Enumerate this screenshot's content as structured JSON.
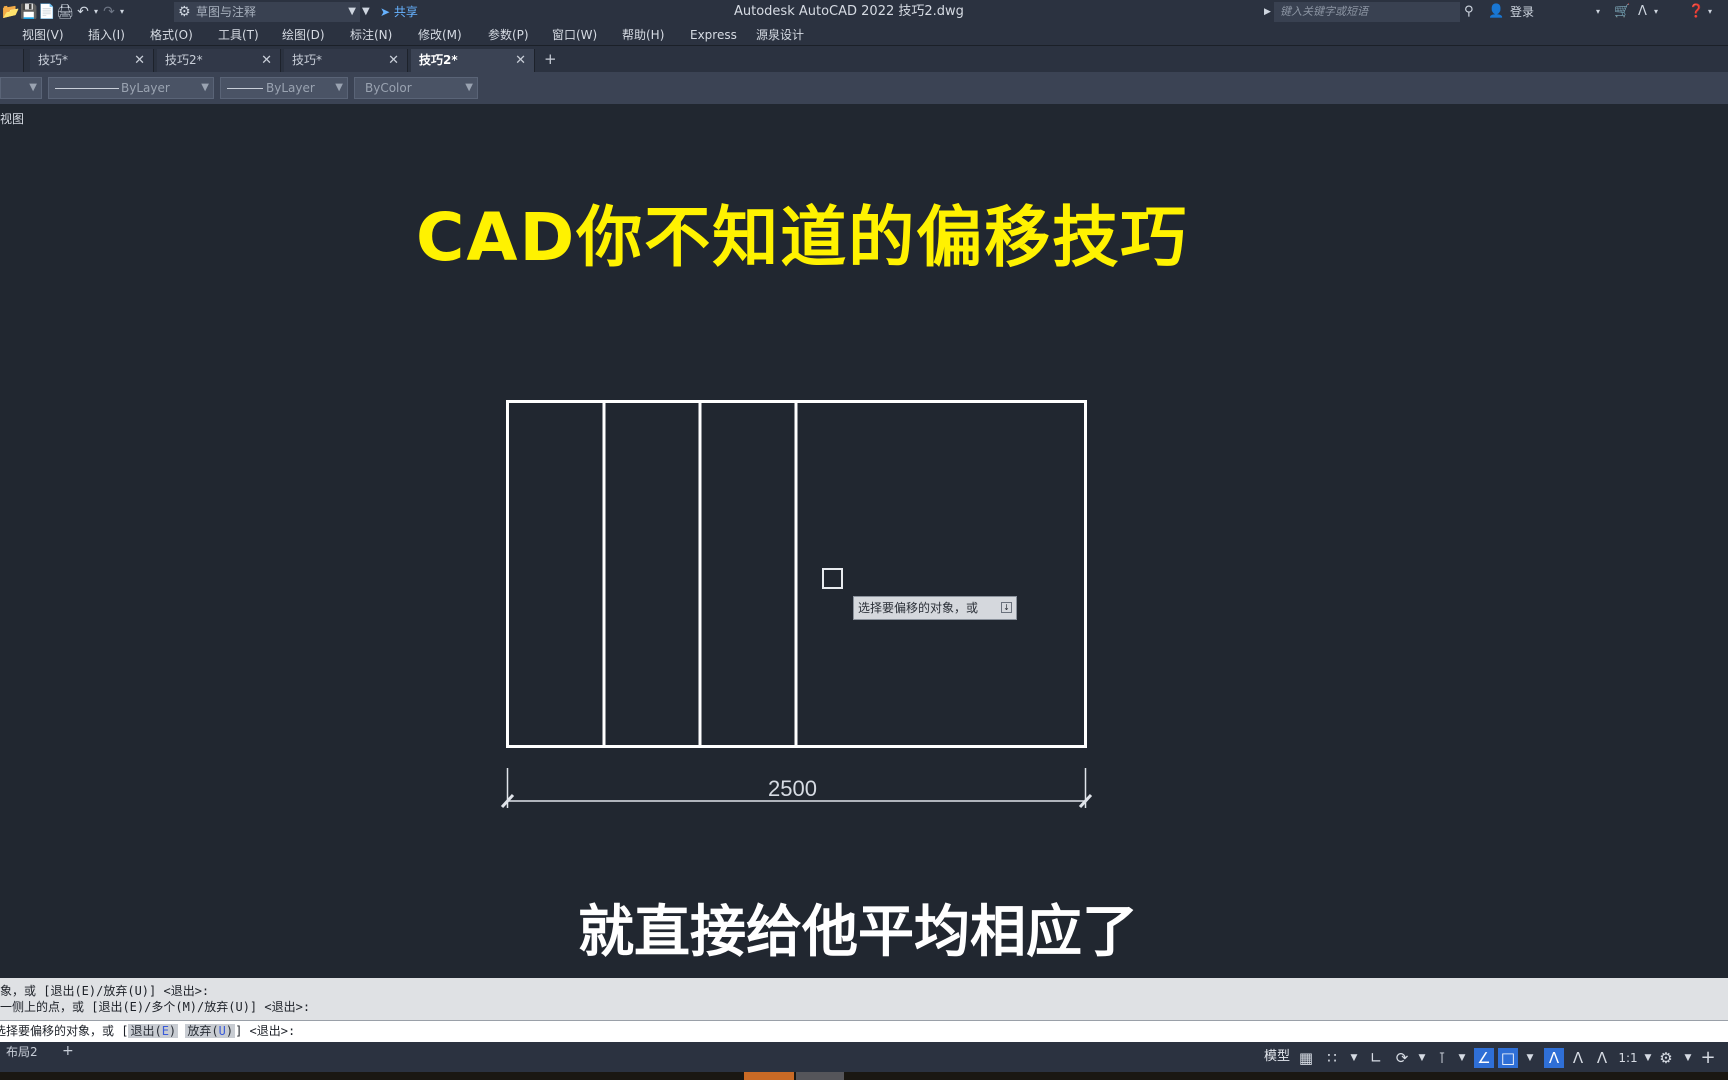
{
  "window": {
    "title": "Autodesk AutoCAD 2022    技巧2.dwg",
    "workspace": "草图与注释",
    "share": "共享",
    "search_placeholder": "键入关键字或短语",
    "login": "登录"
  },
  "menu": [
    "视图(V)",
    "插入(I)",
    "格式(O)",
    "工具(T)",
    "绘图(D)",
    "标注(N)",
    "修改(M)",
    "参数(P)",
    "窗口(W)",
    "帮助(H)",
    "Express",
    "源泉设计"
  ],
  "tabs": [
    {
      "label": "技巧*",
      "active": false
    },
    {
      "label": "技巧2*",
      "active": false
    },
    {
      "label": "技巧*",
      "active": false
    },
    {
      "label": "技巧2*",
      "active": true
    }
  ],
  "properties": {
    "linetype": "ByLayer",
    "lineweight": "ByLayer",
    "plotstyle": "ByColor"
  },
  "viewport_label": "俯视图",
  "headline": "CAD你不知道的偏移技巧",
  "drawing": {
    "dimension": "2500",
    "tooltip": "选择要偏移的对象，或"
  },
  "subtitle": "就直接给他平均相应了",
  "command": {
    "history": [
      "象，或 [退出(E)/放弃(U)] <退出>:",
      "一侧上的点，或 [退出(E)/多个(M)/放弃(U)] <退出>:"
    ],
    "prompt_prefix": "选择要偏移的对象，或 [",
    "option1_label": "退出(",
    "option1_key": "E",
    "option2_label": "放弃(",
    "option2_key": "U",
    "prompt_suffix": "] <退出>:"
  },
  "status": {
    "layout_tab": "布局2",
    "model": "模型",
    "scale": "1:1"
  },
  "colors": {
    "background": "#212730",
    "headline": "#fff200",
    "accent": "#2f6fd6"
  }
}
